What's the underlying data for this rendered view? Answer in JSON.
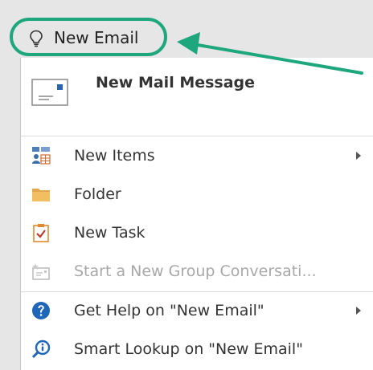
{
  "tell_me": {
    "icon": "lightbulb-icon",
    "text": "New Email"
  },
  "annotation": {
    "highlight_color": "#1ea77d",
    "arrow_color": "#1ea77d"
  },
  "menu": {
    "primary": {
      "icon": "new-mail-envelope-icon",
      "label": "New Mail Message"
    },
    "items": [
      {
        "icon": "new-items-icon",
        "label": "New Items",
        "submenu": true,
        "disabled": false
      },
      {
        "icon": "folder-icon",
        "label": "Folder",
        "submenu": false,
        "disabled": false
      },
      {
        "icon": "task-clipboard-icon",
        "label": "New Task",
        "submenu": false,
        "disabled": false
      },
      {
        "icon": "group-conversation-icon",
        "label": "Start a New Group Conversati...",
        "submenu": false,
        "disabled": true
      },
      {
        "icon": "help-question-icon",
        "label": "Get Help on \"New Email\"",
        "submenu": true,
        "disabled": false
      },
      {
        "icon": "smart-lookup-icon",
        "label": "Smart Lookup on \"New Email\"",
        "submenu": false,
        "disabled": false
      }
    ]
  }
}
